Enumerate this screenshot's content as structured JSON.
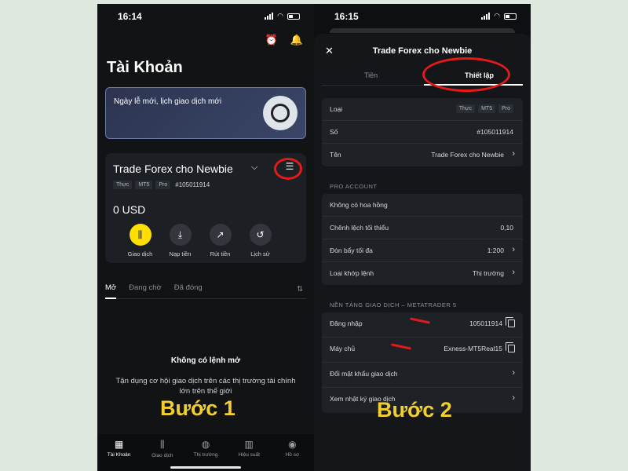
{
  "left": {
    "status_time": "16:14",
    "page_title": "Tài Khoản",
    "banner_text": "Ngày lễ mới, lịch giao dịch mới",
    "account": {
      "name": "Trade Forex cho Newbie",
      "tags": [
        "Thực",
        "MT5",
        "Pro"
      ],
      "number": "#105011914",
      "balance": "0 USD"
    },
    "actions": [
      {
        "label": "Giao dịch",
        "icon": "trade-icon"
      },
      {
        "label": "Nạp tiền",
        "icon": "deposit-icon"
      },
      {
        "label": "Rút tiền",
        "icon": "withdraw-icon"
      },
      {
        "label": "Lịch sử",
        "icon": "history-icon"
      }
    ],
    "order_tabs": [
      "Mở",
      "Đang chờ",
      "Đã đóng"
    ],
    "empty_title": "Không có lệnh mở",
    "empty_sub": "Tận dụng cơ hội giao dịch trên các thị trường tài chính lớn trên thế giới",
    "step_label": "Bước 1",
    "nav": [
      {
        "label": "Tài Khoản",
        "icon": "accounts-icon"
      },
      {
        "label": "Giao dịch",
        "icon": "trade-icon"
      },
      {
        "label": "Thị trường",
        "icon": "globe-icon"
      },
      {
        "label": "Hiệu suất",
        "icon": "performance-icon"
      },
      {
        "label": "Hồ sơ",
        "icon": "profile-icon"
      }
    ]
  },
  "right": {
    "status_time": "16:15",
    "sheet_title": "Trade Forex cho Newbie",
    "tabs": [
      "Tiền",
      "Thiết lập"
    ],
    "info": {
      "type_label": "Loại",
      "type_tags": [
        "Thực",
        "MT5",
        "Pro"
      ],
      "number_label": "Số",
      "number_value": "#105011914",
      "name_label": "Tên",
      "name_value": "Trade Forex cho Newbie"
    },
    "pro_section": "PRO ACCOUNT",
    "pro_rows": [
      {
        "k": "Không có hoa hồng",
        "v": ""
      },
      {
        "k": "Chênh lệch tối thiểu",
        "v": "0,10"
      },
      {
        "k": "Đòn bẩy tối đa",
        "v": "1:200"
      },
      {
        "k": "Loại khớp lệnh",
        "v": "Thị trường"
      }
    ],
    "platform_section": "NỀN TẢNG GIAO DỊCH – METATRADER 5",
    "platform_rows": [
      {
        "k": "Đăng nhập",
        "v": "105011914"
      },
      {
        "k": "Máy chủ",
        "v": "Exness-MT5Real15"
      },
      {
        "k": "Đổi mật khẩu giao dịch",
        "v": ""
      },
      {
        "k": "Xem nhật ký giao dịch",
        "v": ""
      }
    ],
    "step_label": "Bước 2"
  },
  "colors": {
    "accent_yellow": "#ffde02",
    "annotation_red": "#e11a1a",
    "step_text": "#f2cf2e"
  }
}
